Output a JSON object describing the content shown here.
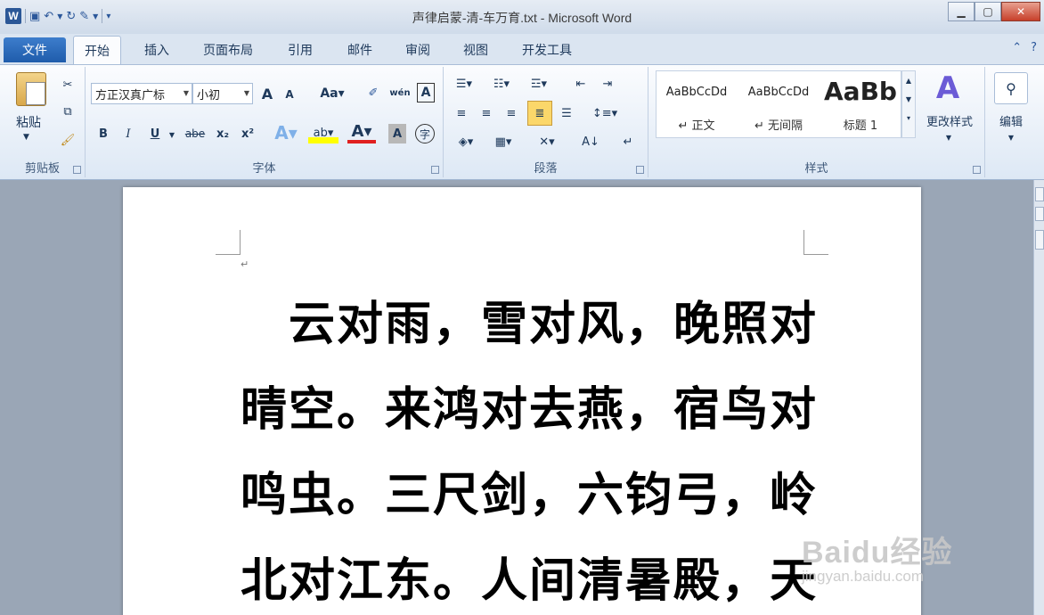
{
  "window": {
    "title": "声律启蒙-清-车万育.txt - Microsoft Word",
    "app_icon": "word-icon"
  },
  "tabs": {
    "file": "文件",
    "items": [
      "开始",
      "插入",
      "页面布局",
      "引用",
      "邮件",
      "审阅",
      "视图",
      "开发工具"
    ],
    "active": "开始"
  },
  "ribbon": {
    "clipboard": {
      "label": "剪贴板",
      "paste_label": "粘贴"
    },
    "font": {
      "label": "字体",
      "font_name": "方正汉真广标",
      "font_size": "小初",
      "buttons": [
        "B",
        "I",
        "U",
        "abe",
        "x₂",
        "x²"
      ],
      "change_case": "Aa",
      "grow": "A",
      "shrink": "A",
      "phonetic": "wén",
      "border_char": "A",
      "enclose_char": "字"
    },
    "paragraph": {
      "label": "段落"
    },
    "styles": {
      "label": "样式",
      "items": [
        {
          "sample": "AaBbCcDd",
          "name": "↵ 正文"
        },
        {
          "sample": "AaBbCcDd",
          "name": "↵ 无间隔"
        },
        {
          "sample": "AaBb",
          "name": "标题 1"
        }
      ],
      "change_styles": "更改样式"
    },
    "editing": {
      "label": "编辑"
    }
  },
  "document": {
    "paragraph_mark": "↵",
    "lines": [
      "　云对雨，雪对风，晚照对",
      "晴空。来鸿对去燕，宿鸟对",
      "鸣虫。三尺剑，六钧弓，岭",
      "北对江东。人间清暑殿，天"
    ]
  },
  "watermark": {
    "line1": "Baidu经验",
    "line2": "jingyan.baidu.com"
  },
  "colors": {
    "file_tab": "#2a66b8",
    "ribbon_bg": "#dde8f5",
    "workspace_bg": "#9aa6b6"
  }
}
